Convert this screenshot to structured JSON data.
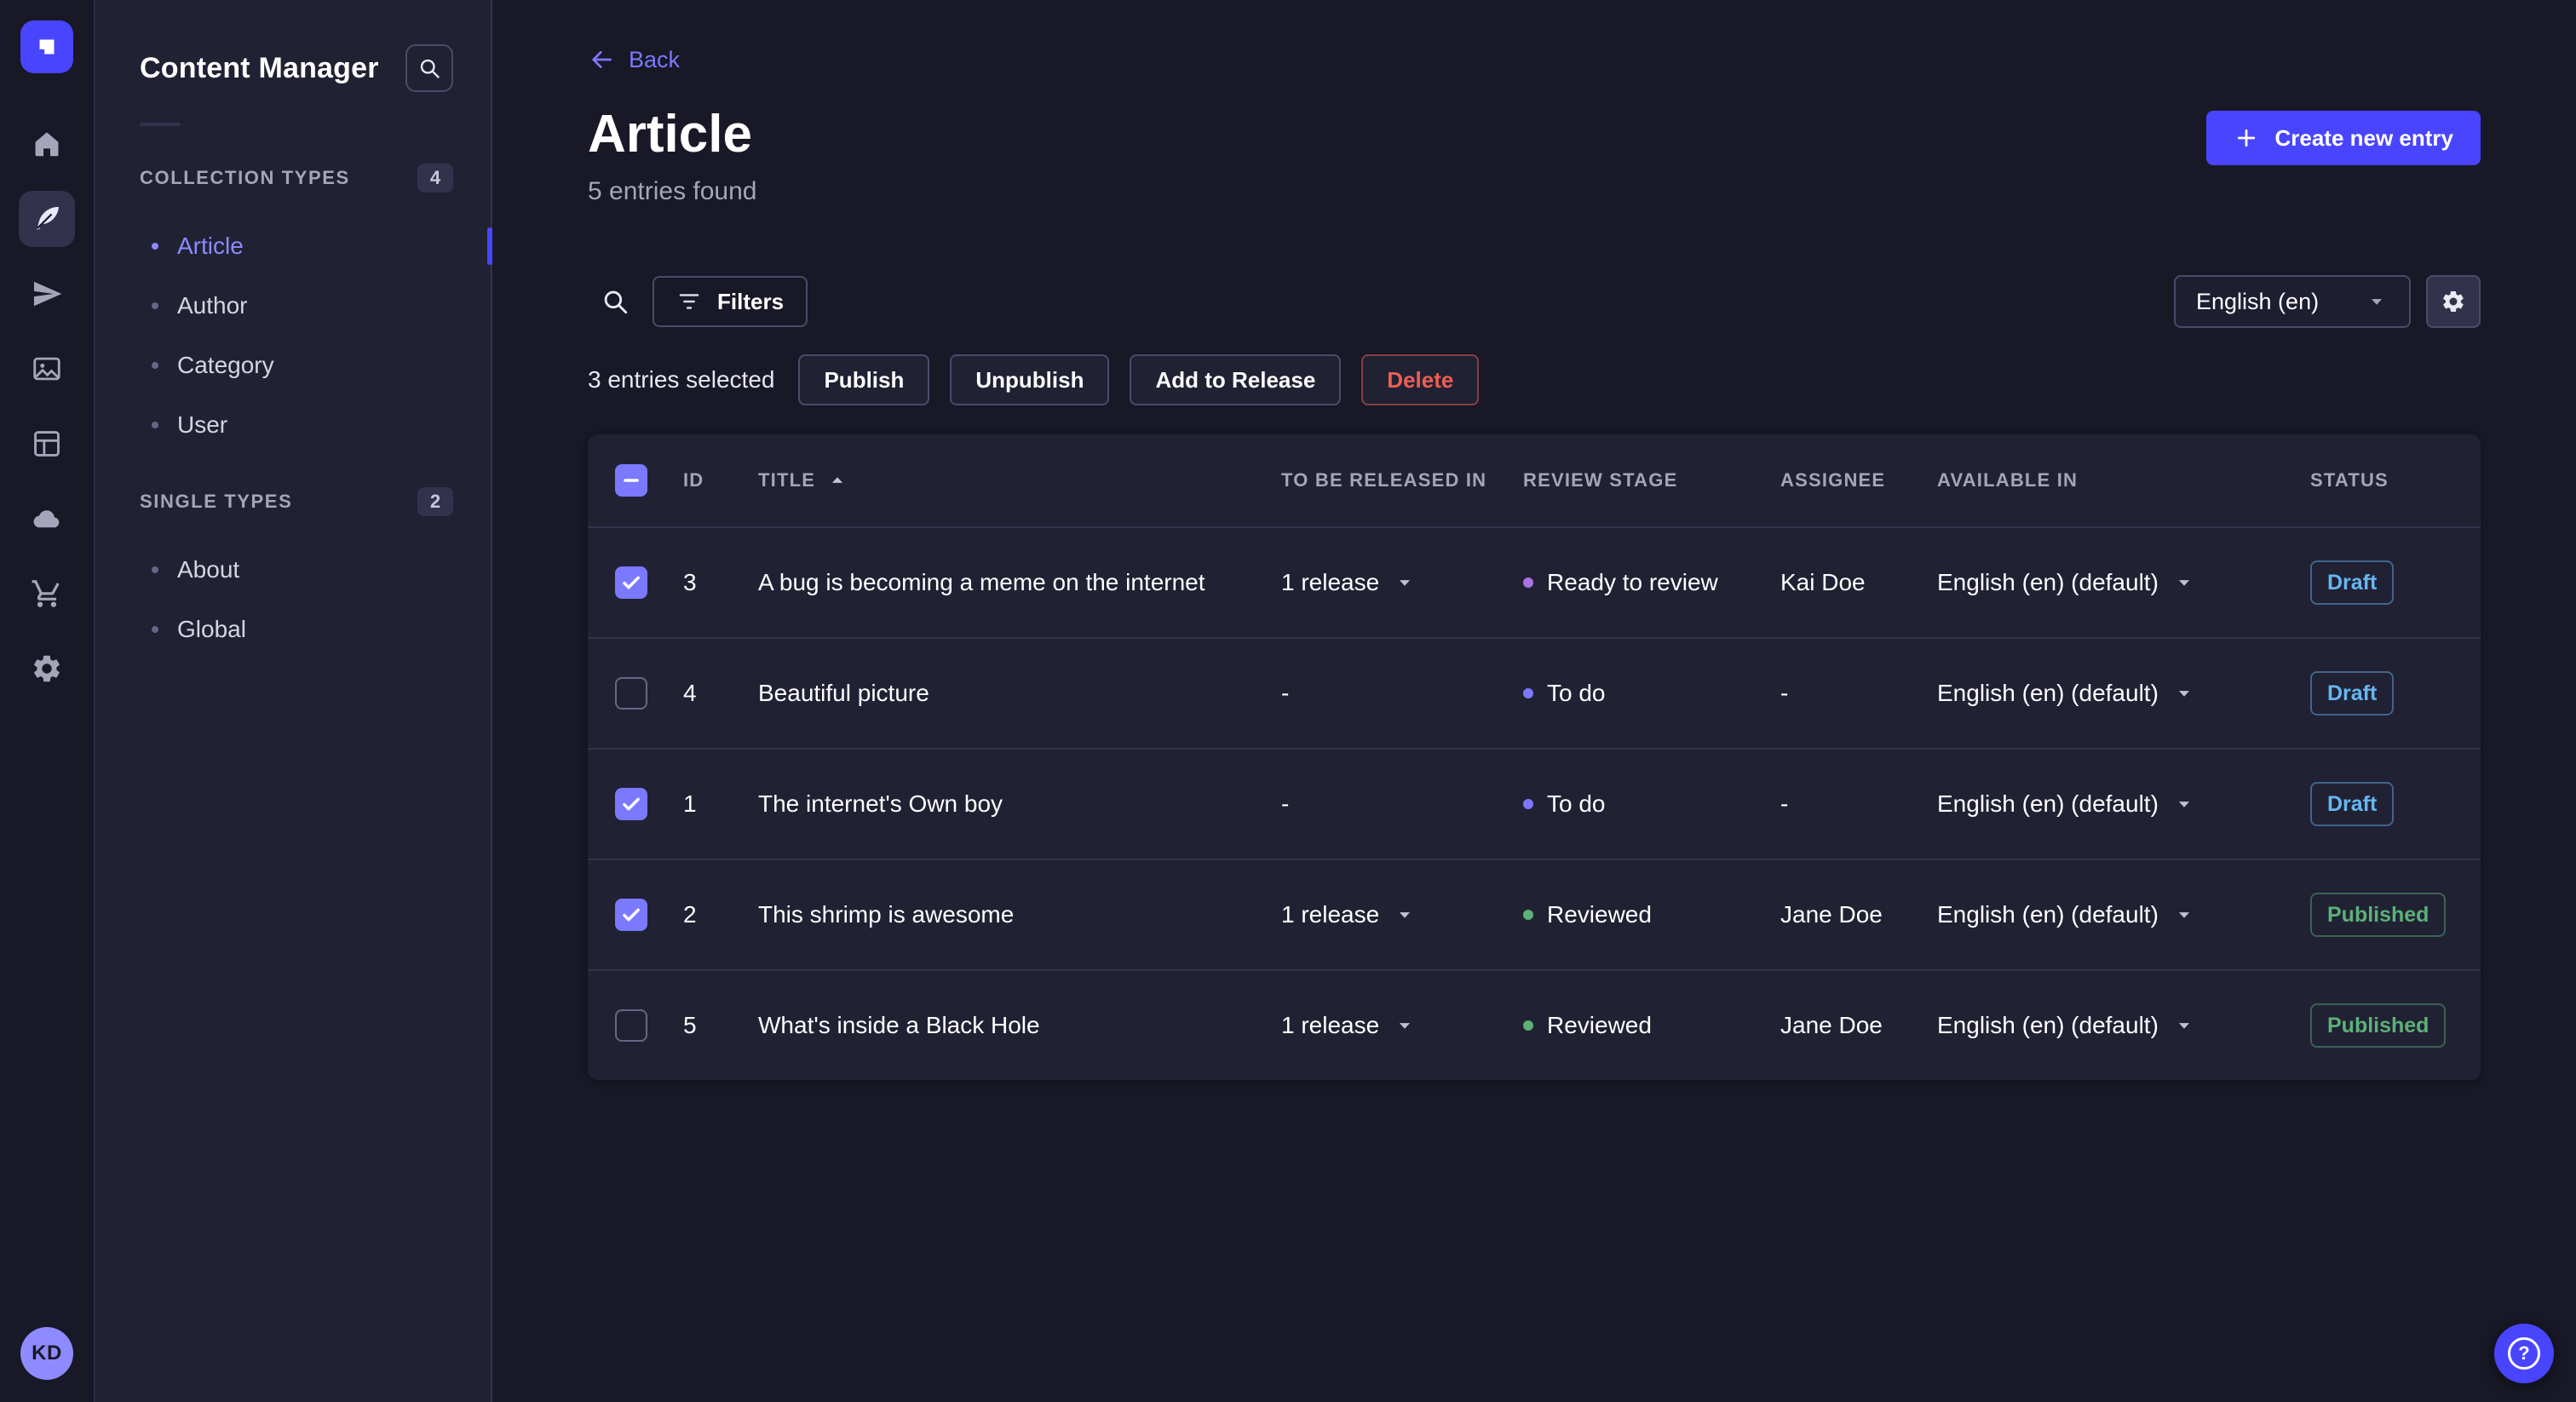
{
  "colors": {
    "primary": "#4945ff",
    "link": "#7b79ff",
    "draft_status": "#66b7f1",
    "published_status": "#5cb176",
    "panel_bg": "#212134",
    "page_bg": "#181826"
  },
  "nav_rail": {
    "icons": [
      "strapi-logo",
      "home",
      "content-manager",
      "paper-plane",
      "media-library",
      "content-type-builder",
      "cloud",
      "marketplace",
      "settings"
    ],
    "active_icon": "content-manager",
    "avatar_initials": "KD"
  },
  "sidebar": {
    "title": "Content Manager",
    "sections": [
      {
        "label": "COLLECTION TYPES",
        "badge": "4",
        "items": [
          {
            "label": "Article",
            "active": true
          },
          {
            "label": "Author",
            "active": false
          },
          {
            "label": "Category",
            "active": false
          },
          {
            "label": "User",
            "active": false
          }
        ]
      },
      {
        "label": "SINGLE TYPES",
        "badge": "2",
        "items": [
          {
            "label": "About",
            "active": false
          },
          {
            "label": "Global",
            "active": false
          }
        ]
      }
    ]
  },
  "header": {
    "back_label": "Back",
    "title": "Article",
    "subtitle": "5 entries found",
    "create_button_label": "Create new entry"
  },
  "toolbar": {
    "filters_label": "Filters",
    "locale_value": "English (en)"
  },
  "selection": {
    "text": "3 entries selected",
    "publish_label": "Publish",
    "unpublish_label": "Unpublish",
    "add_to_release_label": "Add to Release",
    "delete_label": "Delete"
  },
  "table": {
    "columns": {
      "id": "ID",
      "title": "TITLE",
      "release": "TO BE RELEASED IN",
      "review_stage": "REVIEW STAGE",
      "assignee": "ASSIGNEE",
      "available_in": "AVAILABLE IN",
      "status": "STATUS"
    },
    "sorted_by": "TITLE",
    "sort_direction": "asc",
    "rows": [
      {
        "checked": true,
        "id": "3",
        "title": "A bug is becoming a meme on the internet",
        "release": "1 release",
        "release_menu": true,
        "review_stage": "Ready to review",
        "stage_color": "#ac73e6",
        "assignee": "Kai Doe",
        "available_in": "English (en) (default)",
        "status": "Draft"
      },
      {
        "checked": false,
        "id": "4",
        "title": "Beautiful picture",
        "release": "-",
        "release_menu": false,
        "review_stage": "To do",
        "stage_color": "#7b79ff",
        "assignee": "-",
        "available_in": "English (en) (default)",
        "status": "Draft"
      },
      {
        "checked": true,
        "id": "1",
        "title": "The internet's Own boy",
        "release": "-",
        "release_menu": false,
        "review_stage": "To do",
        "stage_color": "#7b79ff",
        "assignee": "-",
        "available_in": "English (en) (default)",
        "status": "Draft"
      },
      {
        "checked": true,
        "id": "2",
        "title": "This shrimp is awesome",
        "release": "1 release",
        "release_menu": true,
        "review_stage": "Reviewed",
        "stage_color": "#5cb176",
        "assignee": "Jane Doe",
        "available_in": "English (en) (default)",
        "status": "Published"
      },
      {
        "checked": false,
        "id": "5",
        "title": "What's inside a Black Hole",
        "release": "1 release",
        "release_menu": true,
        "review_stage": "Reviewed",
        "stage_color": "#5cb176",
        "assignee": "Jane Doe",
        "available_in": "English (en) (default)",
        "status": "Published"
      }
    ]
  },
  "help": {
    "label": "?"
  }
}
